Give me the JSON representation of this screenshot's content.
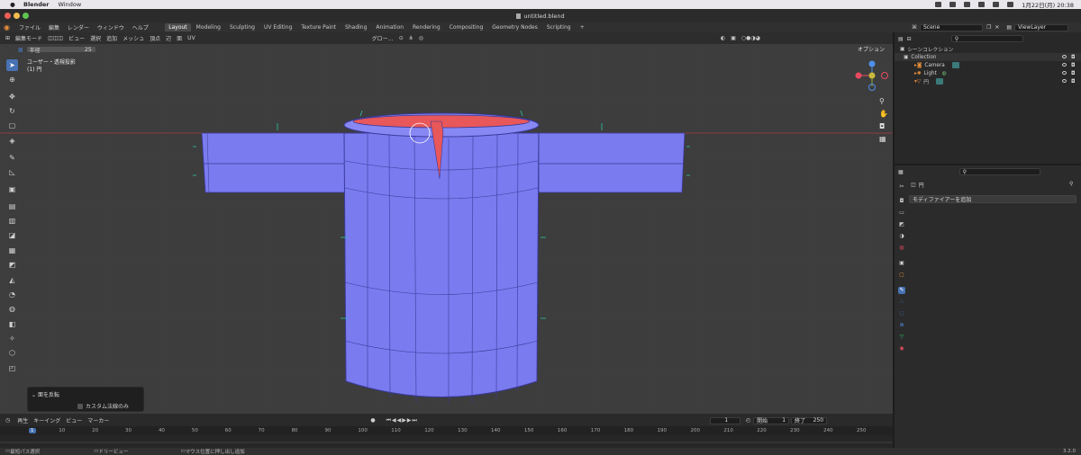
{
  "macmenu": {
    "app": "Blender",
    "window": "Window",
    "clock": "1月22日(月) 20:38"
  },
  "window": {
    "title": "untitled.blend"
  },
  "topbar": {
    "menus": [
      "ファイル",
      "編集",
      "レンダー",
      "ウィンドウ",
      "ヘルプ"
    ],
    "workspaces": [
      "Layout",
      "Modeling",
      "Sculpting",
      "UV Editing",
      "Texture Paint",
      "Shading",
      "Animation",
      "Rendering",
      "Compositing",
      "Geometry Nodes",
      "Scripting"
    ],
    "active_workspace": "Layout",
    "add_tab": "+",
    "scene": "Scene",
    "view_layer": "ViewLayer"
  },
  "viewport_header": {
    "mode": "編集モード",
    "menus": [
      "ビュー",
      "選択",
      "追加",
      "メッシュ",
      "頂点",
      "辺",
      "面",
      "UV"
    ],
    "transform_orientation": "グロー…",
    "options": "オプション"
  },
  "tool_settings": {
    "radius_label": "半径",
    "radius_value": "25"
  },
  "viewport": {
    "view_name": "ユーザー・透視投影",
    "object_name": "(1) 円"
  },
  "colors": {
    "mesh_face": "#7b7bf0",
    "selected_face": "#e8575a",
    "edges": "#3a3a9a",
    "normals": "#2bc4a8",
    "accent": "#4772b3"
  },
  "last_operator": {
    "title": "面を反転",
    "option_label": "カスタム法線のみ",
    "option_checked": false
  },
  "timeline": {
    "menus": [
      "再生",
      "キーイング",
      "ビュー",
      "マーカー"
    ],
    "current_frame": "1",
    "start_label": "開始",
    "start_value": "1",
    "end_label": "終了",
    "end_value": "250",
    "ticks": [
      "1",
      "10",
      "20",
      "30",
      "40",
      "50",
      "60",
      "70",
      "80",
      "90",
      "100",
      "110",
      "120",
      "130",
      "140",
      "150",
      "160",
      "170",
      "180",
      "190",
      "200",
      "210",
      "220",
      "230",
      "240",
      "250"
    ]
  },
  "status_bar": {
    "left": "最短パス選択",
    "mid": "ドリービュー",
    "right": "マウス位置に押し出し追加",
    "version": "3.2.0"
  },
  "outliner": {
    "root": "シーンコレクション",
    "collection": "Collection",
    "items": [
      {
        "name": "Camera",
        "icon": "camera-icon"
      },
      {
        "name": "Light",
        "icon": "light-icon"
      },
      {
        "name": "円",
        "icon": "mesh-icon"
      }
    ]
  },
  "properties": {
    "object_name": "円",
    "add_modifier": "モディファイアーを追加"
  }
}
